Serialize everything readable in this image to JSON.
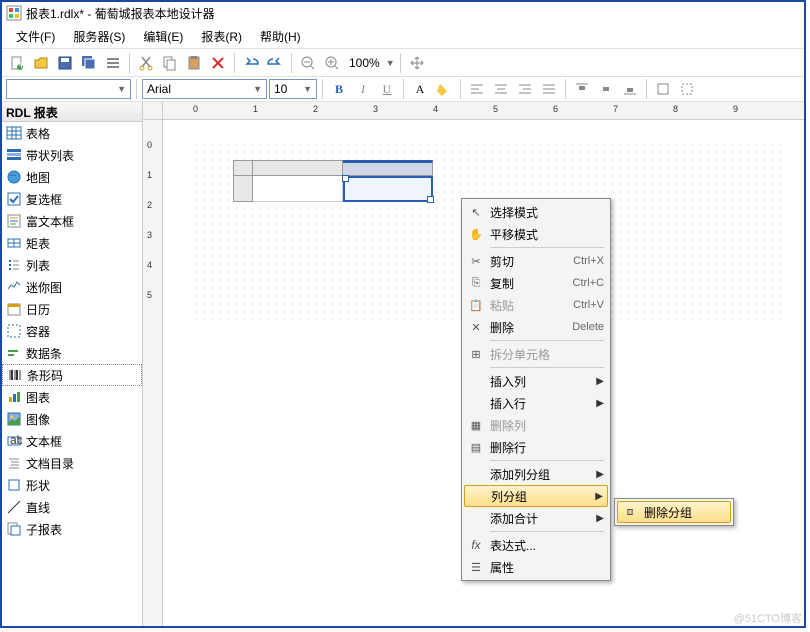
{
  "title": "报表1.rdlx* - 葡萄城报表本地设计器",
  "menubar": [
    "文件(F)",
    "服务器(S)",
    "编辑(E)",
    "报表(R)",
    "帮助(H)"
  ],
  "zoom": "100%",
  "font": {
    "name": "Arial",
    "size": "10"
  },
  "sidebar": {
    "header": "RDL 报表",
    "items": [
      {
        "icon": "table",
        "label": "表格"
      },
      {
        "icon": "bandlist",
        "label": "带状列表"
      },
      {
        "icon": "map",
        "label": "地图"
      },
      {
        "icon": "checkbox",
        "label": "复选框"
      },
      {
        "icon": "richtext",
        "label": "富文本框"
      },
      {
        "icon": "rect",
        "label": "矩表"
      },
      {
        "icon": "list",
        "label": "列表"
      },
      {
        "icon": "sparkline",
        "label": "迷你图"
      },
      {
        "icon": "calendar",
        "label": "日历"
      },
      {
        "icon": "container",
        "label": "容器"
      },
      {
        "icon": "databar",
        "label": "数据条"
      },
      {
        "icon": "barcode",
        "label": "条形码"
      },
      {
        "icon": "chart",
        "label": "图表"
      },
      {
        "icon": "image",
        "label": "图像"
      },
      {
        "icon": "textbox",
        "label": "文本框"
      },
      {
        "icon": "toc",
        "label": "文档目录"
      },
      {
        "icon": "shape",
        "label": "形状"
      },
      {
        "icon": "line",
        "label": "直线"
      },
      {
        "icon": "subreport",
        "label": "子报表"
      }
    ]
  },
  "context_menu": [
    {
      "icon": "cursor",
      "label": "选择模式"
    },
    {
      "icon": "hand",
      "label": "平移模式"
    },
    {
      "sep": true
    },
    {
      "icon": "cut",
      "label": "剪切",
      "shortcut": "Ctrl+X"
    },
    {
      "icon": "copy",
      "label": "复制",
      "shortcut": "Ctrl+C"
    },
    {
      "icon": "paste",
      "label": "粘贴",
      "shortcut": "Ctrl+V",
      "disabled": true
    },
    {
      "icon": "delete",
      "label": "删除",
      "shortcut": "Delete"
    },
    {
      "sep": true
    },
    {
      "icon": "split",
      "label": "拆分单元格",
      "disabled": true
    },
    {
      "sep": true
    },
    {
      "label": "插入列",
      "sub": true
    },
    {
      "label": "插入行",
      "sub": true
    },
    {
      "icon": "delcol",
      "label": "删除列",
      "disabled": true
    },
    {
      "icon": "delrow",
      "label": "删除行"
    },
    {
      "sep": true
    },
    {
      "label": "添加列分组",
      "sub": true
    },
    {
      "label": "列分组",
      "sub": true,
      "highlight": true
    },
    {
      "label": "添加合计",
      "sub": true
    },
    {
      "sep": true
    },
    {
      "icon": "fx",
      "label": "表达式..."
    },
    {
      "icon": "props",
      "label": "属性"
    }
  ],
  "submenu": [
    {
      "icon": "delgroup",
      "label": "删除分组",
      "highlight": true
    }
  ],
  "watermark": "@51CTO博客"
}
